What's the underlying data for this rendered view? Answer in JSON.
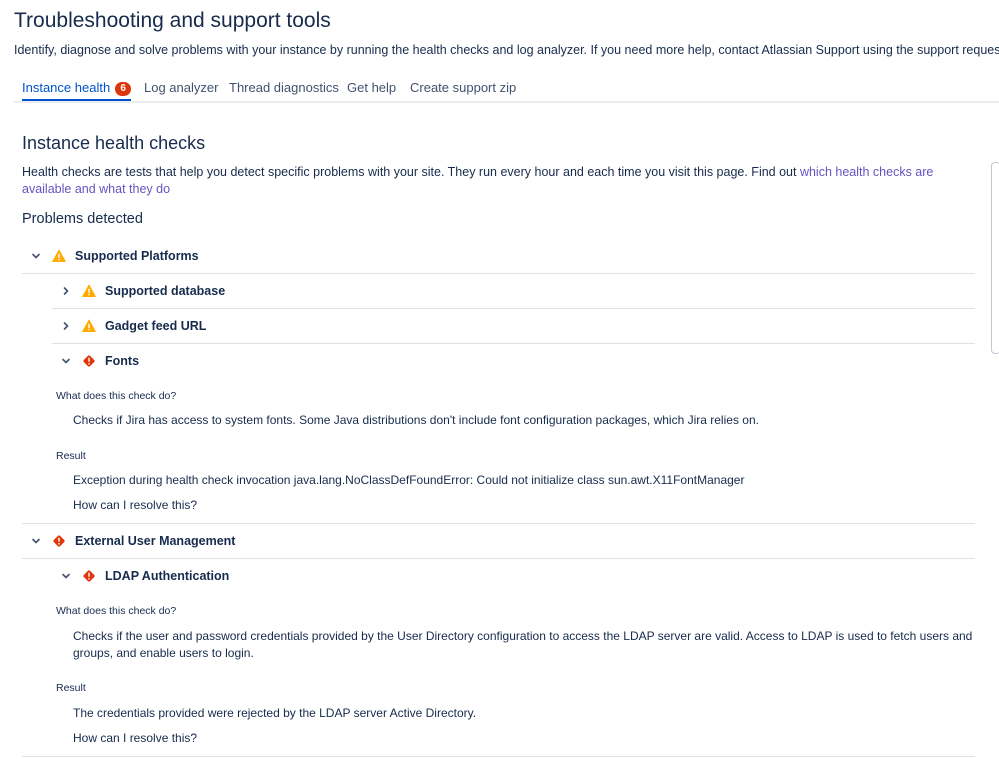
{
  "header": {
    "title": "Troubleshooting and support tools",
    "description": "Identify, diagnose and solve problems with your instance by running the health checks and log analyzer. If you need more help, contact Atlassian Support using the support request form."
  },
  "tabs": [
    {
      "label": "Instance health",
      "badge": "6"
    },
    {
      "label": "Log analyzer"
    },
    {
      "label": "Thread diagnostics"
    },
    {
      "label": "Get help"
    },
    {
      "label": "Create support zip"
    }
  ],
  "section": {
    "title": "Instance health checks",
    "description": "Health checks are tests that help you detect specific problems with your site. They run every hour and each time you visit this page. Find out ",
    "description_link": "which health checks are available and what they do",
    "problems_title": "Problems detected"
  },
  "checks": {
    "supported_platforms": "Supported Platforms",
    "supported_database": "Supported database",
    "gadget_feed_url": "Gadget feed URL",
    "fonts": {
      "label": "Fonts",
      "what_heading": "What does this check do?",
      "what_text": "Checks if Jira has access to system fonts. Some Java distributions don't include font configuration packages, which Jira relies on.",
      "result_heading": "Result",
      "result_text": "Exception during health check invocation java.lang.NoClassDefFoundError: Could not initialize class sun.awt.X11FontManager",
      "resolve_link": "How can I resolve this?"
    },
    "external_user_management": "External User Management",
    "ldap": {
      "label": "LDAP Authentication",
      "what_heading": "What does this check do?",
      "what_text": "Checks if the user and password credentials provided by the User Directory configuration to access the LDAP server are valid. Access to LDAP is used to fetch users and groups, and enable users to login.",
      "result_heading": "Result",
      "result_text": "The credentials provided were rejected by the LDAP server Active Directory.",
      "resolve_link": "How can I resolve this?"
    }
  },
  "icons": {
    "warning": "warning-icon",
    "error": "error-icon",
    "expanded": "chevron-down-icon",
    "collapsed": "chevron-right-icon"
  },
  "colors": {
    "warning": "#FFAB00",
    "error": "#DE350B",
    "link": "#6554C0",
    "tab_active": "#0052CC",
    "text": "#172B4D"
  }
}
